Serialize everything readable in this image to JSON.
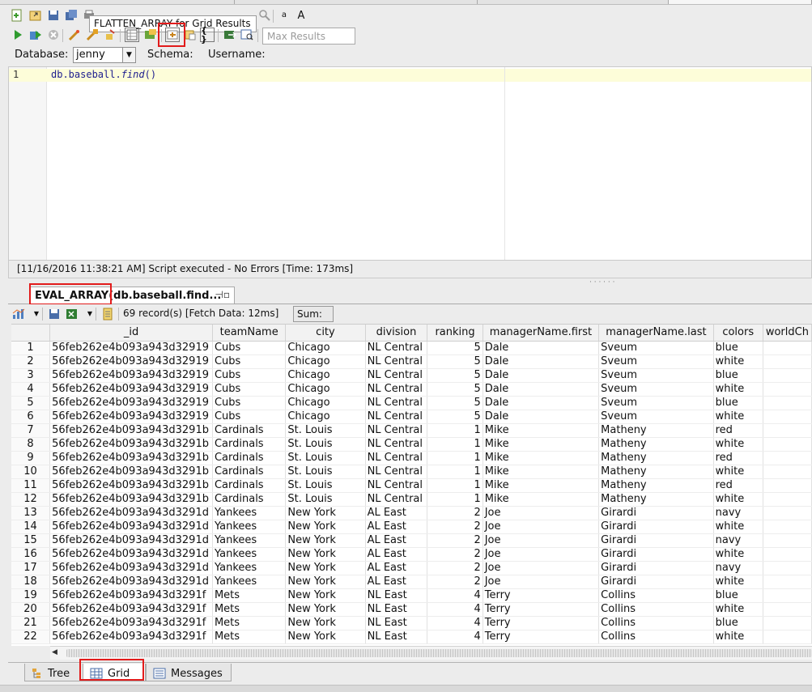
{
  "tooltip": "FLATTEN_ARRAY for Grid Results",
  "toolbar": {
    "max_results_placeholder": "Max Results",
    "font_small": "a",
    "font_large": "A",
    "json_braces": "{ }"
  },
  "connection": {
    "database_label": "Database:",
    "database_value": "jenny",
    "schema_label": "Schema:",
    "username_label": "Username:"
  },
  "editor": {
    "line_number": "1",
    "code_prefix": "db.baseball.",
    "code_func": "find",
    "code_suffix": "()"
  },
  "status": "[11/16/2016 11:38:21 AM] Script executed - No Errors [Time: 173ms]",
  "result_tab": "EVAL_ARRAY(db.baseball.find...",
  "grid_toolbar": {
    "records": "69 record(s) [Fetch Data: 12ms]",
    "sum_label": "Sum:"
  },
  "table": {
    "columns": [
      "_id",
      "teamName",
      "city",
      "division",
      "ranking",
      "managerName.first",
      "managerName.last",
      "colors",
      "worldCh"
    ],
    "rows": [
      [
        "1",
        "56feb262e4b093a943d32919",
        "Cubs",
        "Chicago",
        "NL Central",
        "5",
        "Dale",
        "Sveum",
        "blue",
        ""
      ],
      [
        "2",
        "56feb262e4b093a943d32919",
        "Cubs",
        "Chicago",
        "NL Central",
        "5",
        "Dale",
        "Sveum",
        "white",
        ""
      ],
      [
        "3",
        "56feb262e4b093a943d32919",
        "Cubs",
        "Chicago",
        "NL Central",
        "5",
        "Dale",
        "Sveum",
        "blue",
        ""
      ],
      [
        "4",
        "56feb262e4b093a943d32919",
        "Cubs",
        "Chicago",
        "NL Central",
        "5",
        "Dale",
        "Sveum",
        "white",
        ""
      ],
      [
        "5",
        "56feb262e4b093a943d32919",
        "Cubs",
        "Chicago",
        "NL Central",
        "5",
        "Dale",
        "Sveum",
        "blue",
        ""
      ],
      [
        "6",
        "56feb262e4b093a943d32919",
        "Cubs",
        "Chicago",
        "NL Central",
        "5",
        "Dale",
        "Sveum",
        "white",
        ""
      ],
      [
        "7",
        "56feb262e4b093a943d3291b",
        "Cardinals",
        "St. Louis",
        "NL Central",
        "1",
        "Mike",
        "Matheny",
        "red",
        ""
      ],
      [
        "8",
        "56feb262e4b093a943d3291b",
        "Cardinals",
        "St. Louis",
        "NL Central",
        "1",
        "Mike",
        "Matheny",
        "white",
        ""
      ],
      [
        "9",
        "56feb262e4b093a943d3291b",
        "Cardinals",
        "St. Louis",
        "NL Central",
        "1",
        "Mike",
        "Matheny",
        "red",
        ""
      ],
      [
        "10",
        "56feb262e4b093a943d3291b",
        "Cardinals",
        "St. Louis",
        "NL Central",
        "1",
        "Mike",
        "Matheny",
        "white",
        ""
      ],
      [
        "11",
        "56feb262e4b093a943d3291b",
        "Cardinals",
        "St. Louis",
        "NL Central",
        "1",
        "Mike",
        "Matheny",
        "red",
        ""
      ],
      [
        "12",
        "56feb262e4b093a943d3291b",
        "Cardinals",
        "St. Louis",
        "NL Central",
        "1",
        "Mike",
        "Matheny",
        "white",
        ""
      ],
      [
        "13",
        "56feb262e4b093a943d3291d",
        "Yankees",
        "New York",
        "AL East",
        "2",
        "Joe",
        "Girardi",
        "navy",
        ""
      ],
      [
        "14",
        "56feb262e4b093a943d3291d",
        "Yankees",
        "New York",
        "AL East",
        "2",
        "Joe",
        "Girardi",
        "white",
        ""
      ],
      [
        "15",
        "56feb262e4b093a943d3291d",
        "Yankees",
        "New York",
        "AL East",
        "2",
        "Joe",
        "Girardi",
        "navy",
        ""
      ],
      [
        "16",
        "56feb262e4b093a943d3291d",
        "Yankees",
        "New York",
        "AL East",
        "2",
        "Joe",
        "Girardi",
        "white",
        ""
      ],
      [
        "17",
        "56feb262e4b093a943d3291d",
        "Yankees",
        "New York",
        "AL East",
        "2",
        "Joe",
        "Girardi",
        "navy",
        ""
      ],
      [
        "18",
        "56feb262e4b093a943d3291d",
        "Yankees",
        "New York",
        "AL East",
        "2",
        "Joe",
        "Girardi",
        "white",
        ""
      ],
      [
        "19",
        "56feb262e4b093a943d3291f",
        "Mets",
        "New York",
        "NL East",
        "4",
        "Terry",
        "Collins",
        "blue",
        ""
      ],
      [
        "20",
        "56feb262e4b093a943d3291f",
        "Mets",
        "New York",
        "NL East",
        "4",
        "Terry",
        "Collins",
        "white",
        ""
      ],
      [
        "21",
        "56feb262e4b093a943d3291f",
        "Mets",
        "New York",
        "NL East",
        "4",
        "Terry",
        "Collins",
        "blue",
        ""
      ],
      [
        "22",
        "56feb262e4b093a943d3291f",
        "Mets",
        "New York",
        "NL East",
        "4",
        "Terry",
        "Collins",
        "white",
        ""
      ]
    ]
  },
  "bottom_tabs": [
    {
      "label": "Tree",
      "icon": "tree-icon"
    },
    {
      "label": "Grid",
      "icon": "grid-icon"
    },
    {
      "label": "Messages",
      "icon": "messages-icon"
    }
  ],
  "colors": {
    "highlight_red": "#e21b1b",
    "code_blue": "#1d1d8e",
    "current_line": "#fdfdd9"
  }
}
